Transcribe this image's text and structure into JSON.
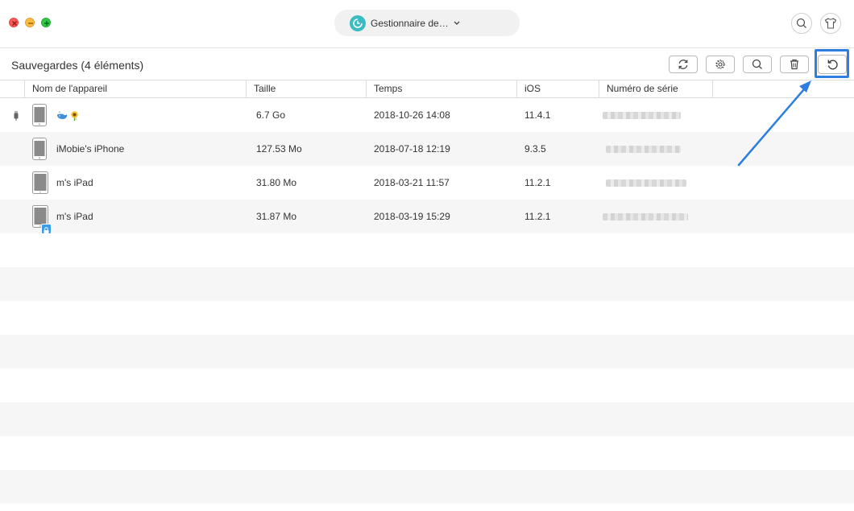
{
  "window": {
    "device_switcher_label": "Gestionnaire de…"
  },
  "toolbar": {
    "section_title": "Sauvegardes (4 éléments)",
    "buttons": [
      "refresh-icon",
      "gear-icon",
      "search-icon",
      "trash-icon",
      "restore-icon"
    ]
  },
  "table": {
    "columns": [
      "Nom de l'appareil",
      "Taille",
      "Temps",
      "iOS",
      "Numéro de série"
    ],
    "rows": [
      {
        "name": "",
        "size": "6.7 Go",
        "time": "2018-10-26 14:08",
        "ios": "11.4.1",
        "device": "iphone",
        "usb": true,
        "emoji": true,
        "lock": false
      },
      {
        "name": "iMobie's iPhone",
        "size": "127.53 Mo",
        "time": "2018-07-18 12:19",
        "ios": "9.3.5",
        "device": "iphone",
        "usb": false,
        "emoji": false,
        "lock": false
      },
      {
        "name": "m's iPad",
        "size": "31.80 Mo",
        "time": "2018-03-21 11:57",
        "ios": "11.2.1",
        "device": "ipad",
        "usb": false,
        "emoji": false,
        "lock": false
      },
      {
        "name": "m's iPad",
        "size": "31.87 Mo",
        "time": "2018-03-19 15:29",
        "ios": "11.2.1",
        "device": "ipad",
        "usb": false,
        "emoji": false,
        "lock": true
      }
    ]
  },
  "colors": {
    "accent": "#2d7ee0",
    "app_icon": "#3cbcc0",
    "stripe": "#f6f6f6"
  }
}
